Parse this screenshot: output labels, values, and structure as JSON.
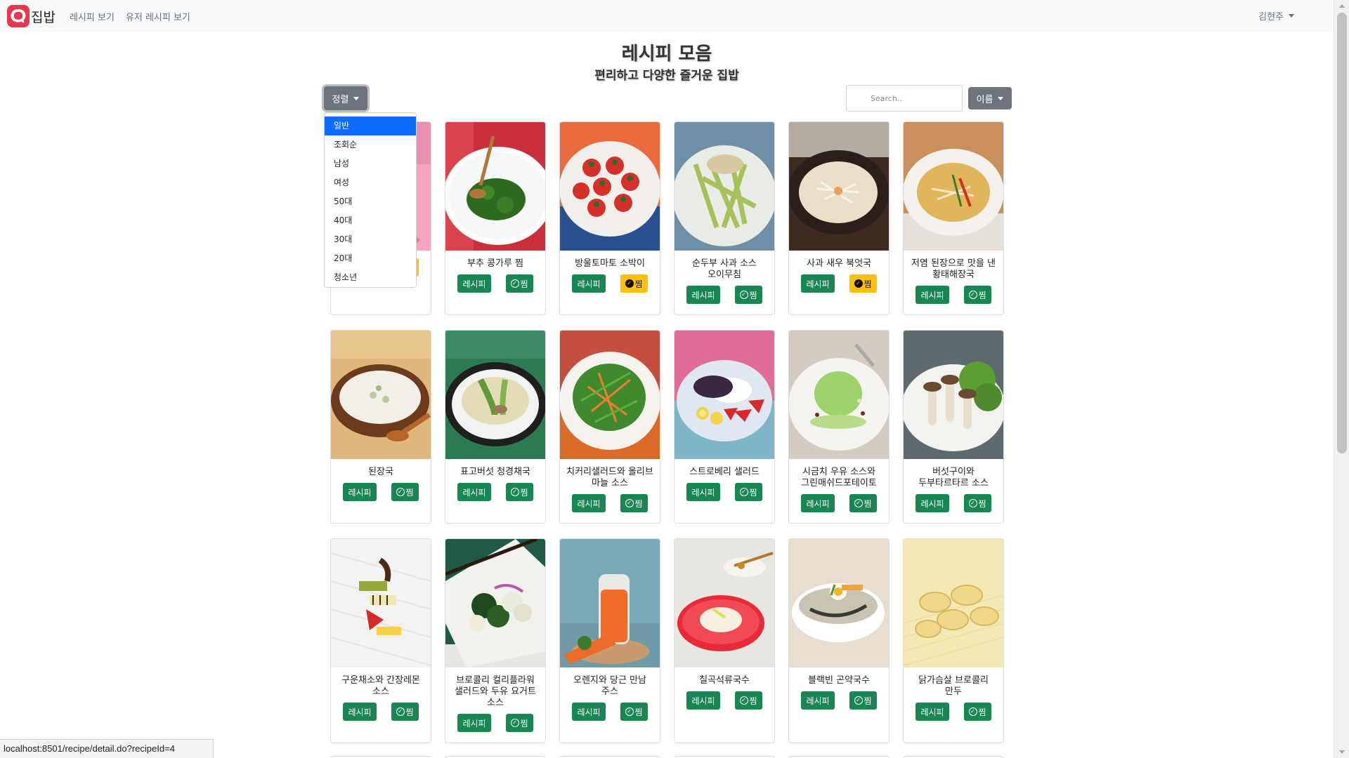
{
  "navbar": {
    "brand": "집밥",
    "links": [
      "레시피 보기",
      "유저 레시피 보기"
    ],
    "user": "김현주"
  },
  "header": {
    "title": "레시피 모음",
    "subtitle": "편리하고 다양한 즐거운 집밥"
  },
  "controls": {
    "sort_label": "정렬",
    "search_placeholder": "Search..",
    "name_label": "이름"
  },
  "dropdown": {
    "items": [
      "일반",
      "조회순",
      "남성",
      "여성",
      "50대",
      "40대",
      "30대",
      "20대",
      "청소년"
    ],
    "active_index": 0
  },
  "card_buttons": {
    "recipe_label": "레시피",
    "zzim_label": "찜"
  },
  "recipes": [
    {
      "title": "",
      "zzim": true,
      "img": "img-bowl-pink"
    },
    {
      "title": "부추 콩가루 찜",
      "zzim": false,
      "img": "img-greens-plate"
    },
    {
      "title": "방울토마토 소박이",
      "zzim": true,
      "img": "img-tomatoes"
    },
    {
      "title": "순두부 사과 소스 오이무침",
      "zzim": false,
      "img": "img-cucumber-salad"
    },
    {
      "title": "사과 새우 북엇국",
      "zzim": true,
      "img": "img-soup-dark"
    },
    {
      "title": "저염 된장으로 맛을 낸 황태해장국",
      "zzim": false,
      "img": "img-soup-clear"
    },
    {
      "title": "된장국",
      "zzim": false,
      "img": "img-white-soup"
    },
    {
      "title": "표고버섯 청경채국",
      "zzim": false,
      "img": "img-bokchoy-soup"
    },
    {
      "title": "치커리샐러드와 올리브 마늘 소스",
      "zzim": false,
      "img": "img-chicory-salad"
    },
    {
      "title": "스트로베리 샐러드",
      "zzim": false,
      "img": "img-strawberry-salad"
    },
    {
      "title": "시금치 우유 소스와 그린매쉬드포테이토",
      "zzim": false,
      "img": "img-green-mash"
    },
    {
      "title": "버섯구이와 두부타르타르 소스",
      "zzim": false,
      "img": "img-mushroom"
    },
    {
      "title": "구운채소와 간장레몬 소스",
      "zzim": false,
      "img": "img-grilled-veg"
    },
    {
      "title": "브로콜리 컬리플라워 샐러드와 두유 요거트 소스",
      "zzim": false,
      "img": "img-broccoli"
    },
    {
      "title": "오렌지와 당근 만남 주스",
      "zzim": false,
      "img": "img-juice"
    },
    {
      "title": "칠곡석류국수",
      "zzim": false,
      "img": "img-red-noodle"
    },
    {
      "title": "블랙빈 곤약국수",
      "zzim": false,
      "img": "img-noodle-bowl"
    },
    {
      "title": "닭가슴살 브로콜리 만두",
      "zzim": false,
      "img": "img-dumplings"
    }
  ],
  "status_url": "localhost:8501/recipe/detail.do?recipeId=4"
}
